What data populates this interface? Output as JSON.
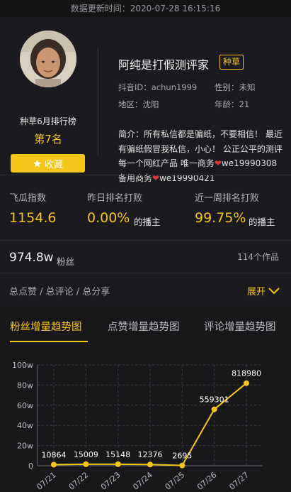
{
  "header": {
    "update_time": "数据更新时间：2020-07-28 16:15:16"
  },
  "profile": {
    "name": "阿纯是打假测评家",
    "tag": "种草",
    "douyin_id": "抖音ID：achun1999",
    "gender": "性别：未知",
    "region": "地区：沈阳",
    "age": "年龄：21",
    "rank_title": "种草6月排行榜",
    "rank_value": "第7名",
    "collect_label": "收藏",
    "bio_part1": "简介：所有私信都是骗纸，不要相信！ 最近有骗纸假冒我私信，小心！ 公正公平的测评每一个网红产品 唯一商务",
    "bio_part2": "we19990308 备用商务",
    "bio_part3": "we19990421"
  },
  "stats": {
    "feigua_label": "飞瓜指数",
    "feigua_value": "1154.6",
    "yesterday_label": "昨日排名打败",
    "yesterday_value": "0.00%",
    "yesterday_suffix": "的播主",
    "week_label": "近一周排名打败",
    "week_value": "99.75%",
    "week_suffix": "的播主"
  },
  "fans": {
    "count": "974.8w",
    "label": "粉丝",
    "works": "114个作品"
  },
  "totals": {
    "label": "总点赞 / 总评论 / 总分享",
    "expand": "展开"
  },
  "tabs": [
    {
      "label": "粉丝增量趋势图"
    },
    {
      "label": "点赞增量趋势图"
    },
    {
      "label": "评论增量趋势图"
    }
  ],
  "colors": {
    "accent": "#f5c518",
    "background": "#1b1b1f",
    "heart": "#e0353b"
  },
  "chart_data": {
    "type": "line",
    "categories": [
      "07/21",
      "07/22",
      "07/23",
      "07/24",
      "07/25",
      "07/26",
      "07/27"
    ],
    "values": [
      10864,
      15009,
      15148,
      12376,
      2695,
      559301,
      818980
    ],
    "y_ticks": [
      "0",
      "20w",
      "40w",
      "60w",
      "80w",
      "100w"
    ],
    "ylim": [
      0,
      1000000
    ],
    "grid": true
  }
}
